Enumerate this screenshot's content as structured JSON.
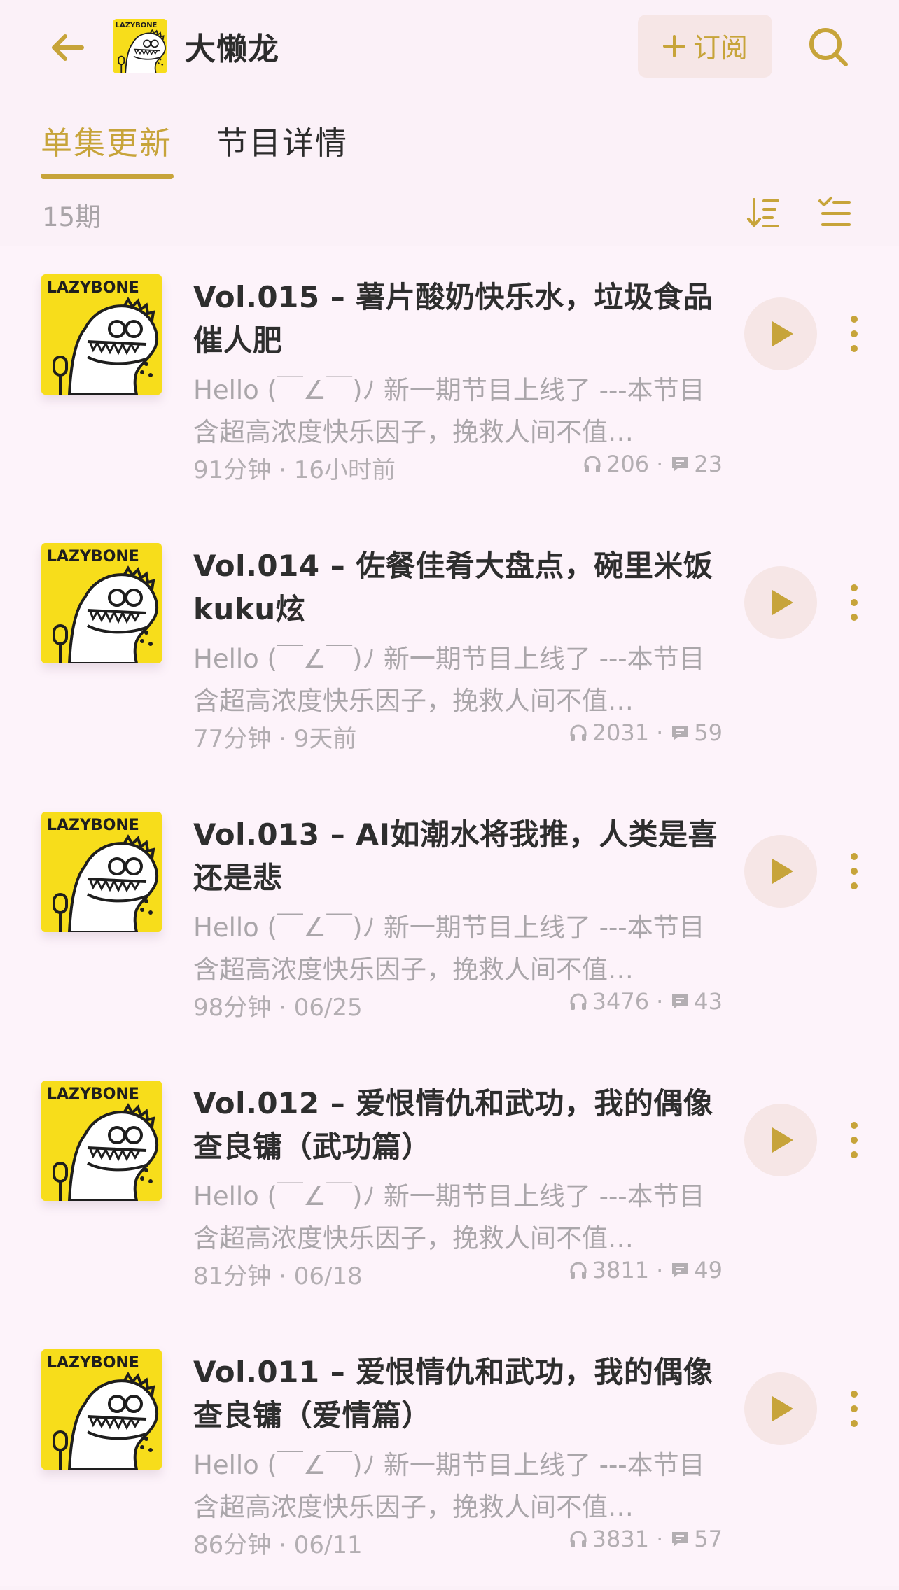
{
  "header": {
    "title": "大懒龙",
    "subscribe_label": "订阅",
    "back_icon": "arrow-left-icon",
    "search_icon": "search-icon",
    "logo_text": "LAZYBONE"
  },
  "tabs": [
    {
      "label": "单集更新",
      "active": true
    },
    {
      "label": "节目详情",
      "active": false
    }
  ],
  "episode_count": "15期",
  "colors": {
    "accent": "#c7a43a",
    "background": "#fbf1f8",
    "cover_yellow": "#f7dd1b",
    "button_bg": "#f6e6e6"
  },
  "episodes": [
    {
      "title": "Vol.015 – 薯片酸奶快乐水，垃圾食品催人肥",
      "description": "Hello (￣∠￣)ﾉ 新一期节目上线了 ---本节目含超高浓度快乐因子，挽救人间不值…",
      "duration": "91分钟",
      "date": "16小时前",
      "plays": "206",
      "comments": "23"
    },
    {
      "title": "Vol.014 – 佐餐佳肴大盘点，碗里米饭kuku炫",
      "description": "Hello (￣∠￣)ﾉ 新一期节目上线了 ---本节目含超高浓度快乐因子，挽救人间不值…",
      "duration": "77分钟",
      "date": "9天前",
      "plays": "2031",
      "comments": "59"
    },
    {
      "title": "Vol.013 – AI如潮水将我推，人类是喜还是悲",
      "description": "Hello (￣∠￣)ﾉ 新一期节目上线了 ---本节目含超高浓度快乐因子，挽救人间不值…",
      "duration": "98分钟",
      "date": "06/25",
      "plays": "3476",
      "comments": "43"
    },
    {
      "title": "Vol.012 – 爱恨情仇和武功，我的偶像查良镛（武功篇）",
      "description": "Hello (￣∠￣)ﾉ 新一期节目上线了 ---本节目含超高浓度快乐因子，挽救人间不值…",
      "duration": "81分钟",
      "date": "06/18",
      "plays": "3811",
      "comments": "49"
    },
    {
      "title": "Vol.011 – 爱恨情仇和武功，我的偶像查良镛（爱情篇）",
      "description": "Hello (￣∠￣)ﾉ 新一期节目上线了 ---本节目含超高浓度快乐因子，挽救人间不值…",
      "duration": "86分钟",
      "date": "06/11",
      "plays": "3831",
      "comments": "57"
    }
  ]
}
